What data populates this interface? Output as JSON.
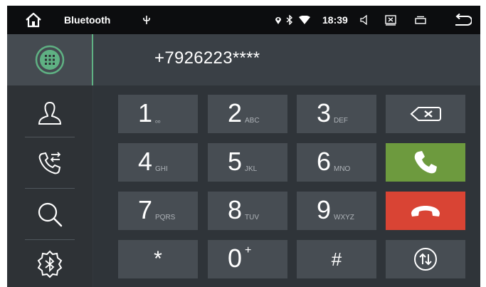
{
  "status_bar": {
    "app_title": "Bluetooth",
    "time": "18:39",
    "icons": [
      "home-icon",
      "usb-icon",
      "location-icon",
      "bluetooth-icon",
      "wifi-icon",
      "volume-icon",
      "close-window-icon",
      "recent-apps-icon",
      "back-icon"
    ]
  },
  "sidebar": {
    "items": [
      {
        "name": "dialpad",
        "icon": "dialpad-icon",
        "active": true
      },
      {
        "name": "contacts",
        "icon": "contacts-icon",
        "active": false
      },
      {
        "name": "call-log",
        "icon": "call-log-icon",
        "active": false
      },
      {
        "name": "search",
        "icon": "search-icon",
        "active": false
      },
      {
        "name": "bluetooth-settings",
        "icon": "bluetooth-settings-icon",
        "active": false
      }
    ]
  },
  "dialer": {
    "number": "+7926223****"
  },
  "keypad": {
    "keys": [
      {
        "digit": "1",
        "letters": "ₒₒ"
      },
      {
        "digit": "2",
        "letters": "ABC"
      },
      {
        "digit": "3",
        "letters": "DEF"
      },
      {
        "digit": "4",
        "letters": "GHI"
      },
      {
        "digit": "5",
        "letters": "JKL"
      },
      {
        "digit": "6",
        "letters": "MNO"
      },
      {
        "digit": "7",
        "letters": "PQRS"
      },
      {
        "digit": "8",
        "letters": "TUV"
      },
      {
        "digit": "9",
        "letters": "WXYZ"
      },
      {
        "digit": "*",
        "letters": ""
      },
      {
        "digit": "0",
        "letters": "+"
      },
      {
        "digit": "#",
        "letters": ""
      }
    ],
    "actions": {
      "backspace_icon": "backspace-icon",
      "call_icon": "call-icon",
      "hangup_icon": "hangup-icon",
      "transfer_icon": "transfer-audio-icon"
    }
  },
  "colors": {
    "accent": "#5fb183",
    "call": "#6d9a3e",
    "hangup": "#d94434"
  }
}
